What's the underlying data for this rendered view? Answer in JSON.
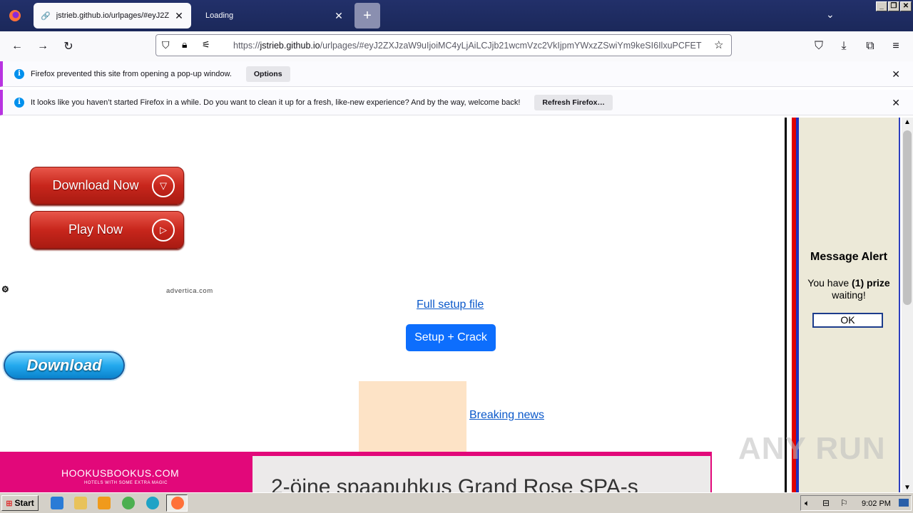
{
  "browser": {
    "tabs": [
      {
        "title": "jstrieb.github.io/urlpages/#eyJ2Z"
      },
      {
        "title": "Loading"
      }
    ],
    "url": {
      "scheme": "https://",
      "host": "jstrieb.github.io",
      "path": "/urlpages/#eyJ2ZXJzaW9uIjoiMC4yLjAiLCJjb21wcmVzc2VkIjpmYWxzZSwiYm9keSI6IlxuPCFET"
    }
  },
  "notifications": [
    {
      "text": "Firefox prevented this site from opening a pop-up window.",
      "button": "Options"
    },
    {
      "text": "It looks like you haven’t started Firefox in a while. Do you want to clean it up for a fresh, like-new experience? And by the way, welcome back!",
      "button": "Refresh Firefox…"
    }
  ],
  "page": {
    "download_now": "Download Now",
    "play_now": "Play Now",
    "advertica": "advertica.com",
    "full_setup": "Full setup file",
    "setup_crack": "Setup + Crack",
    "download": "Download",
    "breaking_news": "Breaking news",
    "ad_brand": "HOOKUSBOOKUS.COM",
    "ad_tagline": "HOTELS WITH SOME EXTRA MAGIC",
    "ad_headline": "2-öine spaapuhkus Grand Rose SPA-s"
  },
  "alert": {
    "title": "Message Alert",
    "msg_pre": "You have ",
    "msg_bold": "(1) prize",
    "msg_post": " waiting!",
    "ok": "OK"
  },
  "watermark": "ANY RUN",
  "taskbar": {
    "start": "Start",
    "clock": "9:02 PM"
  }
}
